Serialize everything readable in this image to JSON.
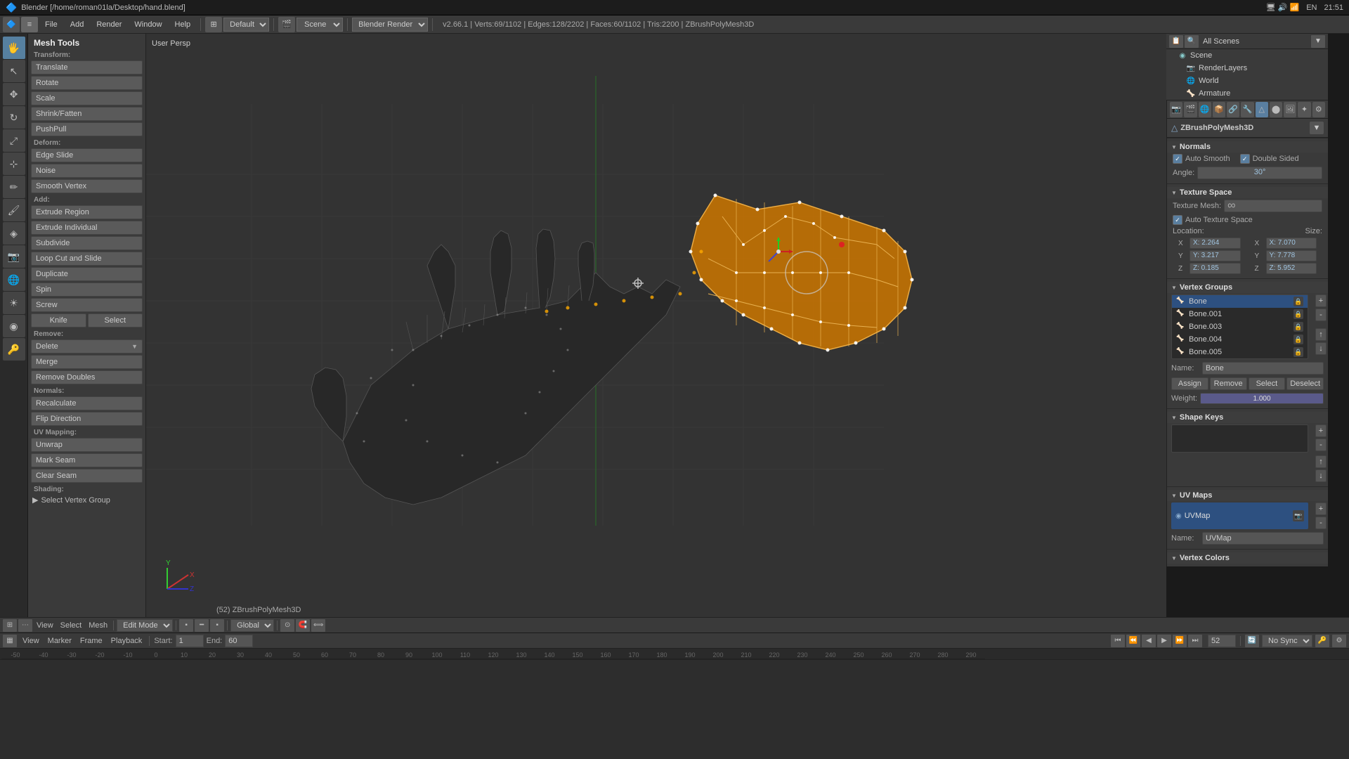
{
  "titlebar": {
    "title": "Blender [/home/roman01la/Desktop/hand.blend]",
    "time": "21:51",
    "lang": "EN"
  },
  "menubar": {
    "engine": "Blender Render",
    "scene": "Scene",
    "layout": "Default",
    "info": "v2.66.1 | Verts:69/1102 | Edges:128/2202 | Faces:60/1102 | Tris:2200 | ZBrushPolyMesh3D"
  },
  "mesh_tools": {
    "title": "Mesh Tools",
    "transform": {
      "label": "Transform:",
      "items": [
        "Translate",
        "Rotate",
        "Scale",
        "Shrink/Fatten",
        "PushPull"
      ]
    },
    "deform": {
      "label": "Deform:",
      "items": [
        "Edge Slide",
        "Noise",
        "Smooth Vertex"
      ]
    },
    "add": {
      "label": "Add:",
      "items": [
        "Extrude Region",
        "Extrude Individual",
        "Subdivide",
        "Loop Cut and Slide",
        "Duplicate",
        "Spin",
        "Screw"
      ]
    },
    "knife_select": [
      "Knife",
      "Select"
    ],
    "remove": {
      "label": "Remove:",
      "items": [
        "Delete",
        "Merge",
        "Remove Doubles"
      ]
    },
    "normals": {
      "label": "Normals:",
      "items": [
        "Recalculate",
        "Flip Direction"
      ]
    },
    "uv_mapping": {
      "label": "UV Mapping:",
      "items": [
        "Unwrap",
        "Mark Seam",
        "Clear Seam"
      ]
    },
    "shading": {
      "label": "Shading:"
    },
    "select_vertex_group": "Select Vertex Group"
  },
  "viewport": {
    "label": "User Persp",
    "bottom_info": "(52) ZBrushPolyMesh3D",
    "mode": "Edit Mode",
    "global": "Global"
  },
  "outliner": {
    "title": "Scene",
    "items": [
      {
        "name": "Scene",
        "type": "scene",
        "indent": 0
      },
      {
        "name": "RenderLayers",
        "type": "camera",
        "indent": 1
      },
      {
        "name": "World",
        "type": "world",
        "indent": 1
      },
      {
        "name": "Armature",
        "type": "mesh",
        "indent": 1
      }
    ]
  },
  "properties": {
    "mesh_name": "ZBrushPolyMesh3D",
    "normals": {
      "title": "Normals",
      "auto_smooth": "Auto Smooth",
      "double_sided": "Double Sided",
      "angle_label": "Angle:",
      "angle_value": "30°"
    },
    "texture_space": {
      "title": "Texture Space",
      "texture_mesh_label": "Texture Mesh:",
      "auto_texture_space": "Auto Texture Space",
      "location_label": "Location:",
      "size_label": "Size:",
      "x1": "X: 2.264",
      "y1": "Y: 3.217",
      "z1": "Z: 0.185",
      "x2": "X: 7.070",
      "y2": "Y: 7.778",
      "z2": "Z: 5.952"
    },
    "vertex_groups": {
      "title": "Vertex Groups",
      "items": [
        {
          "name": "Bone",
          "selected": true
        },
        {
          "name": "Bone.001",
          "selected": false
        },
        {
          "name": "Bone.003",
          "selected": false
        },
        {
          "name": "Bone.004",
          "selected": false
        },
        {
          "name": "Bone.005",
          "selected": false
        }
      ],
      "name_label": "Name:",
      "name_value": "Bone",
      "buttons": [
        "Assign",
        "Remove",
        "Select",
        "Deselect"
      ],
      "weight_label": "Weight:",
      "weight_value": "1.000"
    },
    "shape_keys": {
      "title": "Shape Keys"
    },
    "uv_maps": {
      "title": "UV Maps",
      "items": [
        {
          "name": "UVMap",
          "selected": true
        }
      ],
      "name_label": "Name:",
      "name_value": "UVMap"
    },
    "vertex_colors": {
      "title": "Vertex Colors"
    }
  },
  "timeline": {
    "start": "1",
    "end": "60",
    "current_frame": "52",
    "no_sync": "No Sync",
    "ruler_marks": [
      "-50",
      "-40",
      "-30",
      "-20",
      "-10",
      "0",
      "10",
      "20",
      "30",
      "40",
      "50",
      "60",
      "70",
      "80",
      "90",
      "100",
      "110",
      "120",
      "130",
      "140",
      "150",
      "160",
      "170",
      "180",
      "190",
      "200",
      "210",
      "220",
      "230",
      "240",
      "250",
      "260",
      "270",
      "280",
      "290"
    ]
  },
  "bottom_toolbar": {
    "mode": "Edit Mode",
    "global": "Global",
    "view": "View",
    "select": "Select",
    "mesh": "Mesh"
  }
}
